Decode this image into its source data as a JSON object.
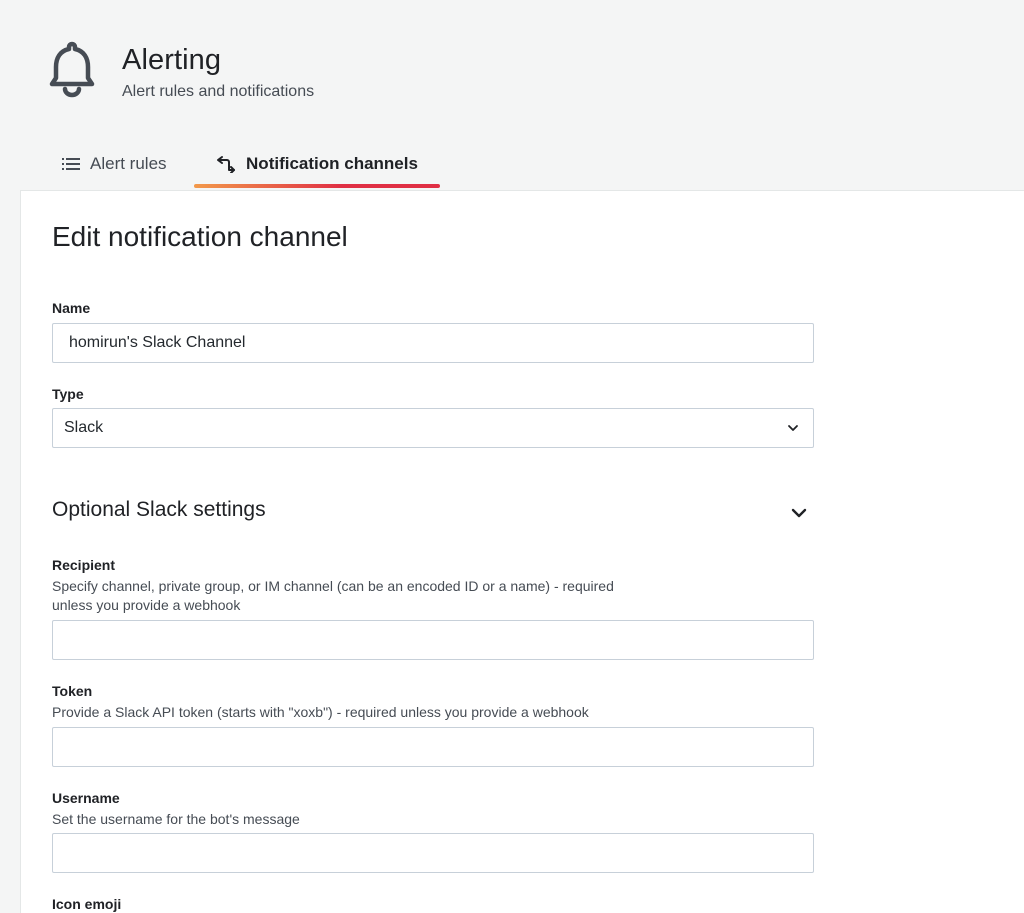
{
  "header": {
    "title": "Alerting",
    "subtitle": "Alert rules and notifications",
    "icon": "bell-icon"
  },
  "tabs": [
    {
      "label": "Alert rules",
      "icon": "list-icon",
      "active": false
    },
    {
      "label": "Notification channels",
      "icon": "channel-icon",
      "active": true
    }
  ],
  "colors": {
    "accent_start": "#f2994a",
    "accent_end": "#e02f44"
  },
  "form": {
    "title": "Edit notification channel",
    "name": {
      "label": "Name",
      "value": "homirun's Slack Channel"
    },
    "type": {
      "label": "Type",
      "value": "Slack",
      "icon": "chevron-down-icon"
    },
    "optional_section": {
      "title": "Optional Slack settings",
      "icon": "chevron-down-icon",
      "expanded": true
    },
    "recipient": {
      "label": "Recipient",
      "description": "Specify channel, private group, or IM channel (can be an encoded ID or a name) - required unless you provide a webhook",
      "value": ""
    },
    "token": {
      "label": "Token",
      "description": "Provide a Slack API token (starts with \"xoxb\") - required unless you provide a webhook",
      "value": ""
    },
    "username": {
      "label": "Username",
      "description": "Set the username for the bot's message",
      "value": ""
    },
    "icon_emoji": {
      "label": "Icon emoji"
    }
  }
}
